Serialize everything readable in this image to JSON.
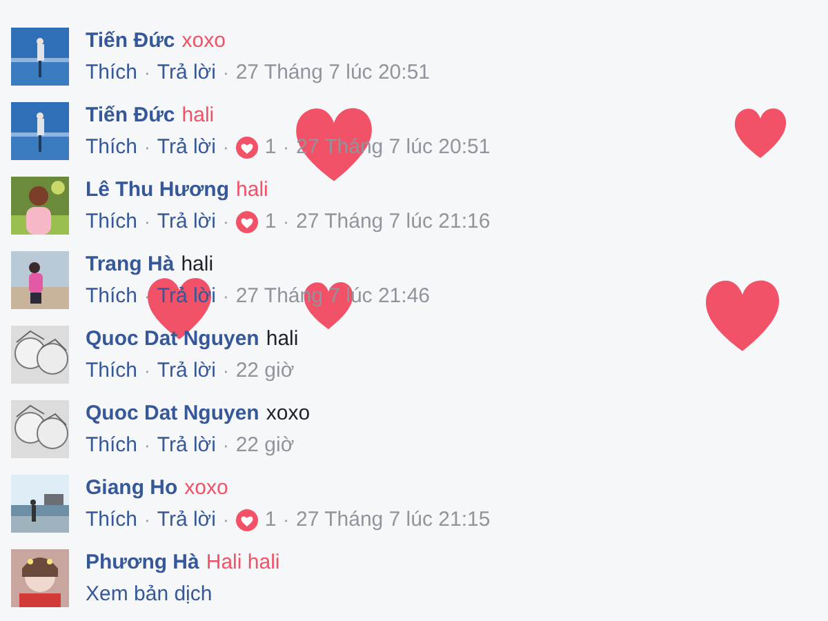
{
  "comments": [
    {
      "author": "Tiến Đức",
      "text": "xoxo",
      "color": "#f25268",
      "meta": [
        {
          "kind": "link",
          "label": "Thích"
        },
        {
          "kind": "link",
          "sep": "·",
          "label": "Trả lời"
        },
        {
          "kind": "time",
          "sep": "·",
          "label": "27 Tháng 7 lúc 20:51"
        }
      ]
    },
    {
      "author": "Tiến Đức",
      "text": "hali",
      "color": "#f25268",
      "meta": [
        {
          "kind": "link",
          "label": "Thích"
        },
        {
          "kind": "link",
          "sep": "·",
          "label": "Trả lời"
        },
        {
          "kind": "reaction",
          "sep": "·",
          "label": "1"
        },
        {
          "kind": "time",
          "sep": "·",
          "label": "27 Tháng 7 lúc 20:51"
        }
      ]
    },
    {
      "author": "Lê Thu Hương",
      "text": "hali",
      "color": "#f25268",
      "meta": [
        {
          "kind": "link",
          "label": "Thích"
        },
        {
          "kind": "link",
          "sep": "·",
          "label": "Trả lời"
        },
        {
          "kind": "reaction",
          "sep": "·",
          "label": "1"
        },
        {
          "kind": "time",
          "sep": "·",
          "label": "27 Tháng 7 lúc 21:16"
        }
      ]
    },
    {
      "author": "Trang Hà",
      "text": "hali",
      "color": "#1d2129",
      "meta": [
        {
          "kind": "link",
          "label": "Thích"
        },
        {
          "kind": "link",
          "sep": "·",
          "label": "Trả lời"
        },
        {
          "kind": "time",
          "sep": "·",
          "label": "27 Tháng 7 lúc 21:46"
        }
      ]
    },
    {
      "author": "Quoc Dat Nguyen",
      "text": "hali",
      "color": "#1d2129",
      "meta": [
        {
          "kind": "link",
          "label": "Thích"
        },
        {
          "kind": "link",
          "sep": "·",
          "label": "Trả lời"
        },
        {
          "kind": "time",
          "sep": "·",
          "label": "22 giờ"
        }
      ]
    },
    {
      "author": "Quoc Dat Nguyen",
      "text": "xoxo",
      "color": "#1d2129",
      "meta": [
        {
          "kind": "link",
          "label": "Thích"
        },
        {
          "kind": "link",
          "sep": "·",
          "label": "Trả lời"
        },
        {
          "kind": "time",
          "sep": "·",
          "label": "22 giờ"
        }
      ]
    },
    {
      "author": "Giang Ho",
      "text": "xoxo",
      "color": "#f25268",
      "meta": [
        {
          "kind": "link",
          "label": "Thích"
        },
        {
          "kind": "link",
          "sep": "·",
          "label": "Trả lời"
        },
        {
          "kind": "reaction",
          "sep": "·",
          "label": "1"
        },
        {
          "kind": "time",
          "sep": "·",
          "label": "27 Tháng 7 lúc 21:15"
        }
      ]
    },
    {
      "author": "Phương Hà",
      "text": "Hali hali",
      "color": "#f25268",
      "meta": [
        {
          "kind": "link",
          "label": "Xem bản dịch"
        }
      ]
    }
  ]
}
